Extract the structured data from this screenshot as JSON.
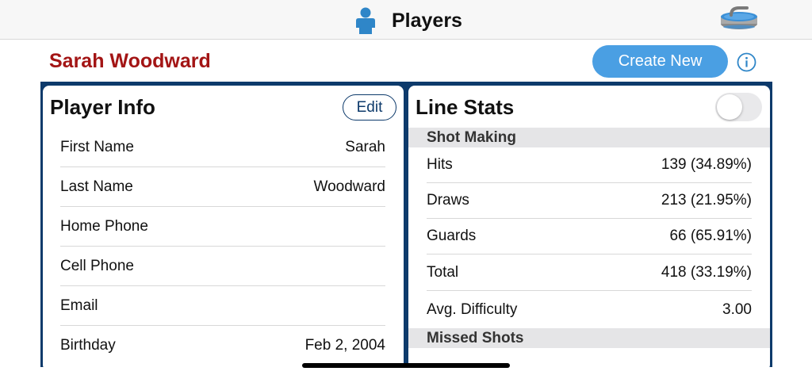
{
  "nav": {
    "title": "Players",
    "icons": {
      "left": "person-icon",
      "right": "curling-stone-icon"
    },
    "colors": {
      "person": "#2f86c8",
      "stone_top": "#3a8fd6",
      "stone_body": "#a9a9a9"
    }
  },
  "header": {
    "player_name": "Sarah Woodward",
    "create_label": "Create New",
    "info_icon": "info-icon",
    "colors": {
      "name": "#a31515",
      "create_bg": "#4a9fe3",
      "info": "#2f86c8"
    }
  },
  "player_info": {
    "title": "Player Info",
    "edit_label": "Edit",
    "rows": [
      {
        "label": "First Name",
        "value": "Sarah"
      },
      {
        "label": "Last Name",
        "value": "Woodward"
      },
      {
        "label": "Home Phone",
        "value": ""
      },
      {
        "label": "Cell Phone",
        "value": ""
      },
      {
        "label": "Email",
        "value": ""
      },
      {
        "label": "Birthday",
        "value": "Feb 2, 2004"
      }
    ]
  },
  "line_stats": {
    "title": "Line Stats",
    "toggle_on": false,
    "sections": [
      {
        "header": "Shot Making",
        "rows": [
          {
            "label": "Hits",
            "value": "139 (34.89%)"
          },
          {
            "label": "Draws",
            "value": "213 (21.95%)"
          },
          {
            "label": "Guards",
            "value": "66 (65.91%)"
          },
          {
            "label": "Total",
            "value": "418 (33.19%)"
          },
          {
            "label": "Avg. Difficulty",
            "value": "3.00"
          }
        ]
      },
      {
        "header": "Missed Shots",
        "rows": []
      }
    ]
  },
  "theme": {
    "frame": "#0d3a6b",
    "separator": "#d8d8d8",
    "section_bg": "#e5e5e7"
  }
}
